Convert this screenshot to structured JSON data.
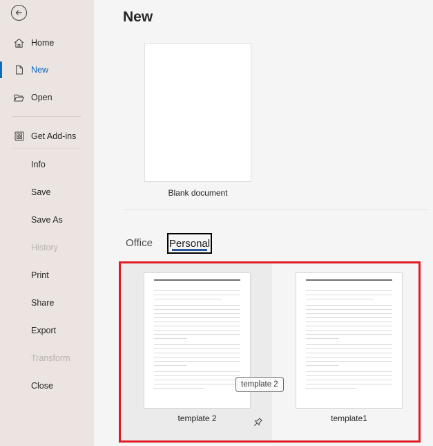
{
  "sidebar": {
    "back": {
      "icon": "back-arrow-icon"
    },
    "items": [
      {
        "label": "Home",
        "icon": "home-icon",
        "state": "normal"
      },
      {
        "label": "New",
        "icon": "new-document-icon",
        "state": "selected"
      },
      {
        "label": "Open",
        "icon": "open-folder-icon",
        "state": "normal"
      },
      {
        "label": "Get Add-ins",
        "icon": "add-ins-grid-icon",
        "state": "normal"
      },
      {
        "label": "Info",
        "state": "normal"
      },
      {
        "label": "Save",
        "state": "normal"
      },
      {
        "label": "Save As",
        "state": "normal"
      },
      {
        "label": "History",
        "state": "disabled"
      },
      {
        "label": "Print",
        "state": "normal"
      },
      {
        "label": "Share",
        "state": "normal"
      },
      {
        "label": "Export",
        "state": "normal"
      },
      {
        "label": "Transform",
        "state": "disabled"
      },
      {
        "label": "Close",
        "state": "normal"
      }
    ]
  },
  "main": {
    "title": "New",
    "blank_document_label": "Blank document",
    "tabs": [
      {
        "label": "Office",
        "selected": false
      },
      {
        "label": "Personal",
        "selected": true
      }
    ],
    "templates": [
      {
        "label": "template 2",
        "highlighted": true,
        "pin_icon": "pin-icon"
      },
      {
        "label": "template1",
        "highlighted": false
      }
    ],
    "tooltip": "template 2"
  },
  "thumbnail": {
    "line_groups": [
      [
        100,
        100,
        78
      ],
      [
        100,
        100,
        100,
        100,
        100,
        100,
        100,
        100,
        38
      ],
      [
        100,
        100,
        100,
        100,
        100,
        38
      ],
      [
        100,
        100,
        100,
        100,
        58
      ]
    ]
  },
  "colors": {
    "accent_blue": "#0f6cbd",
    "tab_underline_blue": "#2b579a",
    "annotation_red": "#e01b24",
    "sidebar_bg": "#ece4e1",
    "main_bg": "#f5f5f5",
    "card_hover_gray": "#ebebeb"
  }
}
